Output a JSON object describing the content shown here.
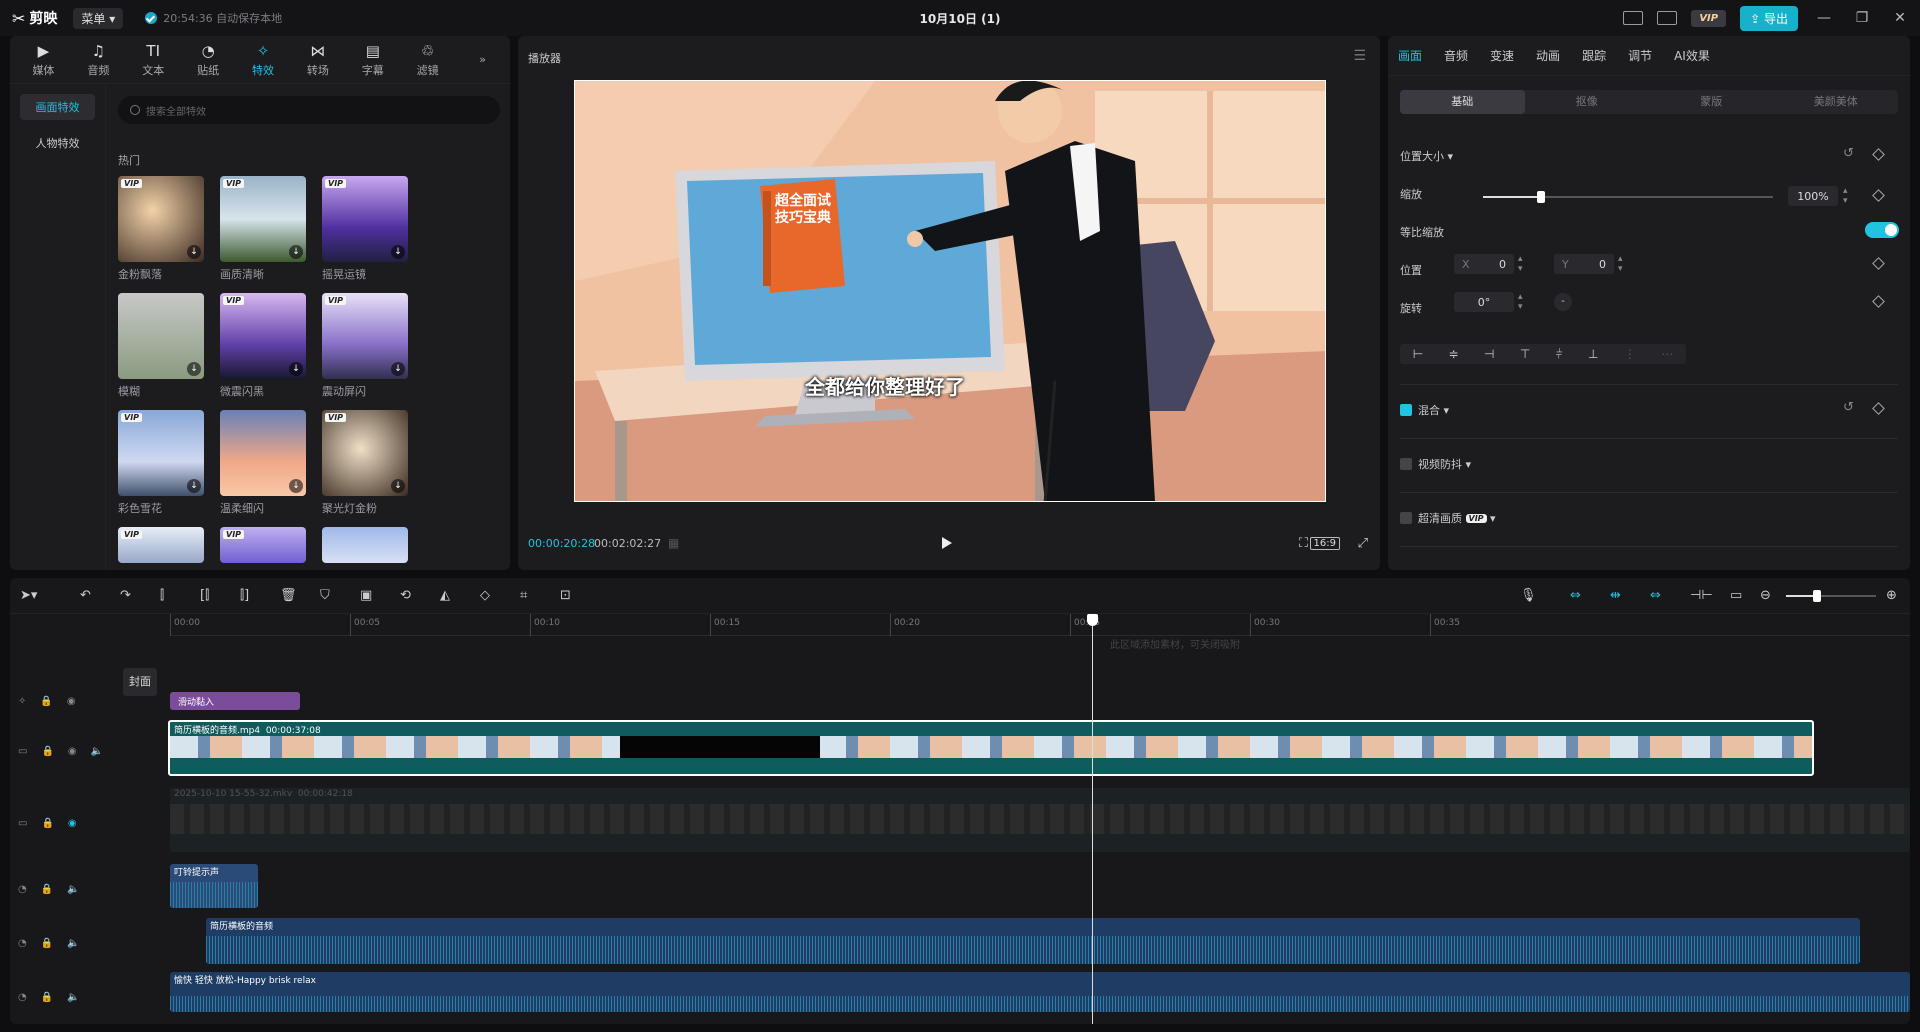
{
  "titlebar": {
    "app_name": "剪映",
    "menu_label": "菜单",
    "save_status": "20:54:36 自动保存本地",
    "project_title": "10月10日 (1)",
    "vip_label": "VIP",
    "export_label": "导出"
  },
  "media_tabs": [
    {
      "label": "媒体",
      "icon": "media-icon"
    },
    {
      "label": "音频",
      "icon": "audio-icon"
    },
    {
      "label": "文本",
      "icon": "text-icon"
    },
    {
      "label": "贴纸",
      "icon": "sticker-icon"
    },
    {
      "label": "特效",
      "icon": "effects-icon",
      "active": true
    },
    {
      "label": "转场",
      "icon": "transition-icon"
    },
    {
      "label": "字幕",
      "icon": "subtitle-icon"
    },
    {
      "label": "滤镜",
      "icon": "filter-icon"
    }
  ],
  "effects": {
    "categories": [
      "画面特效",
      "人物特效"
    ],
    "search_placeholder": "搜索全部特效",
    "section_title": "热门",
    "items": [
      {
        "label": "金粉飘落",
        "vip": "VIP"
      },
      {
        "label": "画质清晰",
        "vip": "VIP"
      },
      {
        "label": "摇晃运镜",
        "vip": "VIP"
      },
      {
        "label": "模糊",
        "vip": ""
      },
      {
        "label": "微震闪黑",
        "vip": "VIP"
      },
      {
        "label": "震动屏闪",
        "vip": "VIP"
      },
      {
        "label": "彩色雪花",
        "vip": "VIP"
      },
      {
        "label": "温柔细闪",
        "vip": ""
      },
      {
        "label": "聚光灯金粉",
        "vip": "VIP"
      },
      {
        "label": "",
        "vip": "VIP"
      },
      {
        "label": "",
        "vip": "VIP"
      },
      {
        "label": "",
        "vip": ""
      }
    ]
  },
  "player": {
    "title": "播放器",
    "subtitle_text": "全都给你整理好了",
    "book_title_line1": "超全面试",
    "book_title_line2": "技巧宝典",
    "current_time": "00:00:20:28",
    "total_time": "00:02:02:27",
    "ratio_label": "16:9"
  },
  "properties": {
    "tabs": [
      "画面",
      "音频",
      "变速",
      "动画",
      "跟踪",
      "调节",
      "AI效果"
    ],
    "segments": [
      "基础",
      "抠像",
      "蒙版",
      "美颜美体"
    ],
    "position_size_label": "位置大小",
    "scale_label": "缩放",
    "scale_value": "100%",
    "scale_fraction": 0.2,
    "uniform_scale_label": "等比缩放",
    "position_label": "位置",
    "pos_x_label": "X",
    "pos_x": "0",
    "pos_y_label": "Y",
    "pos_y": "0",
    "rotate_label": "旋转",
    "rotate_value": "0°",
    "blend_label": "混合",
    "stabilize_label": "视频防抖",
    "hd_label": "超清画质",
    "hd_vip": "VIP"
  },
  "timeline": {
    "ruler_ticks": [
      "00:00",
      "00:05",
      "00:10",
      "00:15",
      "00:20",
      "00:25",
      "00:30",
      "00:35"
    ],
    "hint": "此区域添加素材，可关闭吸附",
    "effect_clip": "滑动黏入",
    "main_clip_name": "简历横板的音频.mp4",
    "main_clip_duration": "00:00:37:08",
    "ghost_clip_name": "2025-10-10 15-55-32.mkv",
    "ghost_clip_duration": "00:00:42:18",
    "cover_label": "封面",
    "audio_clips": [
      {
        "name": "叮铃提示声"
      },
      {
        "name": "简历横板的音频"
      },
      {
        "name": "愉快 轻快 放松-Happy brisk relax"
      }
    ]
  }
}
